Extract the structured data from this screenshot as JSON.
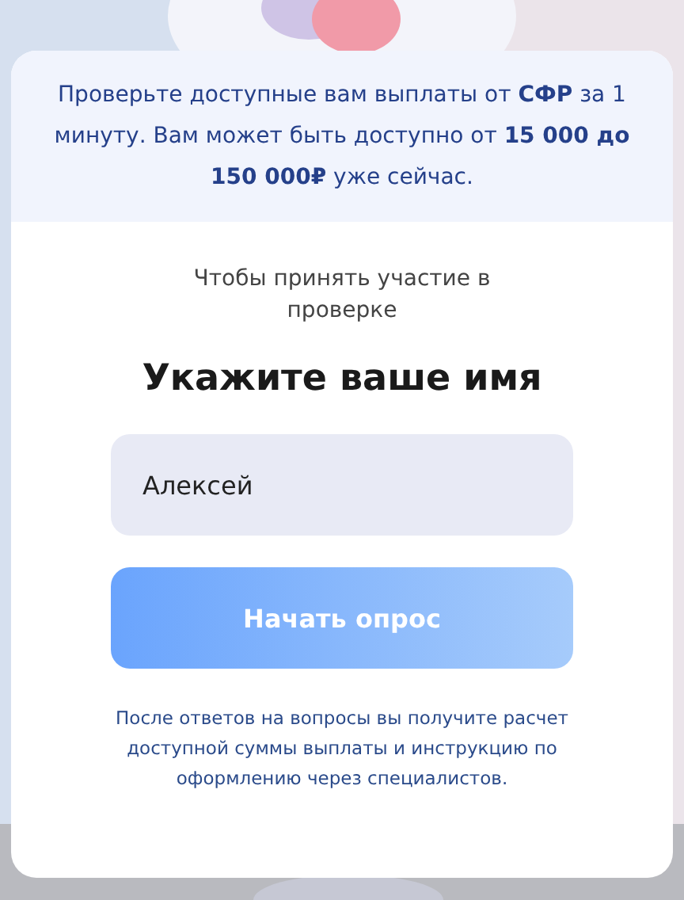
{
  "banner": {
    "text": "Проверьте доступные вам выплаты от **СФР** за 1 минуту. Вам может быть доступно от **15 000 до 150 000₽** уже сейчас."
  },
  "subtitle": "Чтобы принять участие в проверке",
  "heading": "Укажите ваше имя",
  "name_field": {
    "value": "Алексей"
  },
  "start_button": "Начать опрос",
  "footnote": "После ответов на вопросы вы получите расчет доступной суммы выплаты и инструкцию по оформлению через специалистов."
}
